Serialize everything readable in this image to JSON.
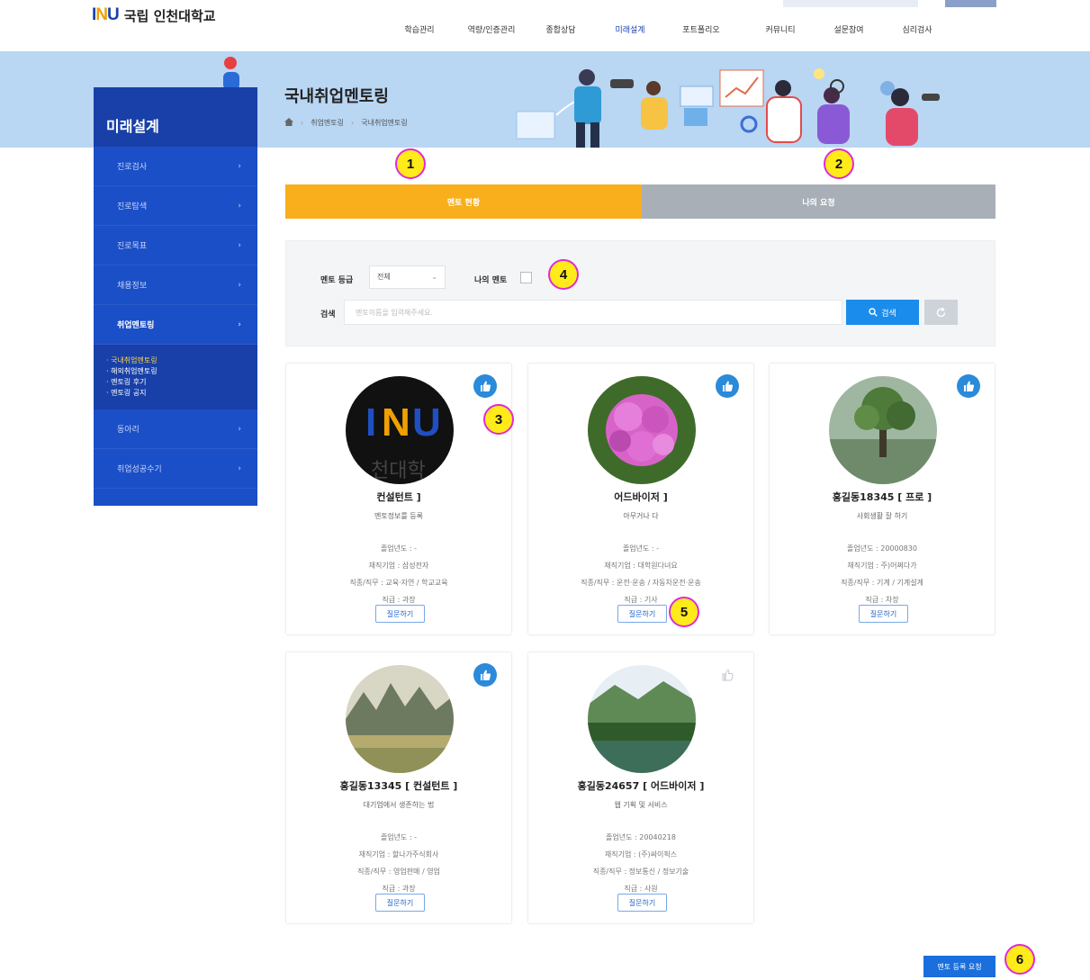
{
  "header": {
    "logo_mark": [
      "I",
      "N",
      "U"
    ],
    "logo_text": "국립 인천대학교",
    "nav": [
      {
        "label": "학습관리",
        "active": false
      },
      {
        "label": "역량/인증관리",
        "active": false
      },
      {
        "label": "종합상담",
        "active": false
      },
      {
        "label": "미래설계",
        "active": true
      },
      {
        "label": "포트폴리오",
        "active": false
      },
      {
        "label": "커뮤니티",
        "active": false
      },
      {
        "label": "설문참여",
        "active": false
      },
      {
        "label": "심리검사",
        "active": false
      }
    ]
  },
  "banner": {
    "title": "국내취업멘토링",
    "breadcrumb": [
      "취업멘토링",
      "국내취업멘토링"
    ]
  },
  "sidebar": {
    "title": "미래설계",
    "items": [
      {
        "label": "진로검사",
        "active": false
      },
      {
        "label": "진로탐색",
        "active": false
      },
      {
        "label": "진로목표",
        "active": false
      },
      {
        "label": "채용정보",
        "active": false
      },
      {
        "label": "취업멘토링",
        "active": true
      }
    ],
    "sub_items": [
      {
        "label": "· 국내취업멘토링",
        "current": true
      },
      {
        "label": "· 해외취업멘토링",
        "current": false
      },
      {
        "label": "· 멘토링 후기",
        "current": false
      },
      {
        "label": "· 멘토링 공지",
        "current": false
      }
    ],
    "items_after": [
      {
        "label": "동아리"
      },
      {
        "label": "취업성공수기"
      }
    ]
  },
  "tabs": [
    {
      "label": "멘토 현황",
      "active": true
    },
    {
      "label": "나의 요청",
      "active": false
    }
  ],
  "search": {
    "grade_label": "멘토 등급",
    "grade_value": "전체",
    "my_mentor_label": "나의 멘토",
    "keyword_label": "검색",
    "placeholder": "멘토이름을 입력해주세요.",
    "search_button": "검색"
  },
  "mentors": [
    {
      "name": "컨설턴트 ]",
      "intro": "멘토정보를 등록",
      "year": "졸업년도 : -",
      "company": "재직기업 : 삼성전자",
      "job": "직종/직무 : 교육·자연 / 학교교육",
      "rank": "직급 : 과장",
      "ask": "질문하기",
      "liked": true,
      "photo": "logo"
    },
    {
      "name": "어드바이저 ]",
      "intro": "아무거나 다",
      "year": "졸업년도 : -",
      "company": "재직기업 : 대학원다녀요",
      "job": "직종/직무 : 운전·운송 / 자동차운전·운송",
      "rank": "직급 : 기사",
      "ask": "질문하기",
      "liked": true,
      "photo": "flower"
    },
    {
      "name": "홍길동18345 [ 프로 ]",
      "intro": "사회생활 잘 하기",
      "year": "졸업년도 : 20000830",
      "company": "재직기업 : 주)어쩌다가",
      "job": "직종/직무 : 기계 / 기계설계",
      "rank": "직급 : 차장",
      "ask": "질문하기",
      "liked": true,
      "photo": "tree"
    },
    {
      "name": "홍길동13345 [ 컨설턴트 ]",
      "intro": "대기업에서 생존하는 법",
      "year": "졸업년도 : -",
      "company": "재직기업 : 할나가주식회사",
      "job": "직종/직무 : 영업판매 / 영업",
      "rank": "직급 : 과장",
      "ask": "질문하기",
      "liked": true,
      "photo": "mountain"
    },
    {
      "name": "홍길동24657 [ 어드바이저 ]",
      "intro": "웹 기획 및 서비스",
      "year": "졸업년도 : 20040218",
      "company": "재직기업 : (주)싸이픽스",
      "job": "직종/직무 : 정보통신 / 정보기술",
      "rank": "직급 : 사원",
      "ask": "질문하기",
      "liked": false,
      "photo": "lake"
    }
  ],
  "register_button": "멘토 등록 요청",
  "markers": [
    "1",
    "2",
    "3",
    "4",
    "5",
    "6"
  ]
}
